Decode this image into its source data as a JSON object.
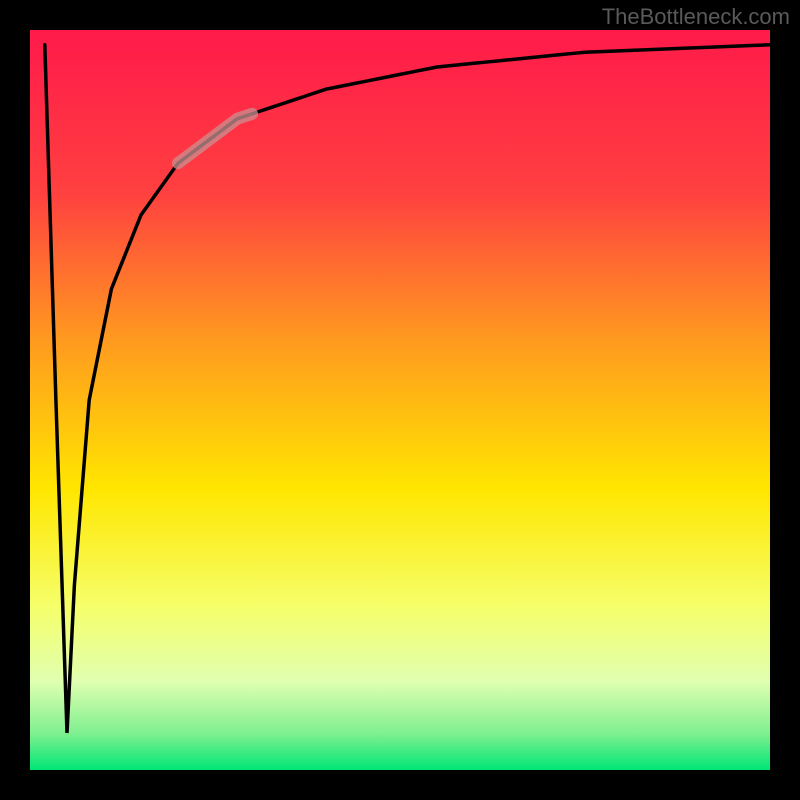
{
  "watermark": "TheBottleneck.com",
  "chart_data": {
    "type": "line",
    "title": "",
    "xlabel": "",
    "ylabel": "",
    "xlim": [
      0,
      100
    ],
    "ylim": [
      0,
      100
    ],
    "description": "Bottleneck percentage curve showing a V-shaped dip near the origin followed by an asymptotic rise toward 100%",
    "gradient_colors": {
      "top": "#ff1a4a",
      "mid_upper": "#ff6b35",
      "mid": "#ffd400",
      "mid_lower": "#f5ff8a",
      "lower": "#e8ffcc",
      "bottom": "#00e676"
    },
    "highlight_region": {
      "x_start": 20,
      "x_end": 30,
      "note": "faded/highlighted segment of curve"
    },
    "series": [
      {
        "name": "bottleneck-curve",
        "points": [
          {
            "x": 2.0,
            "y": 98
          },
          {
            "x": 3.5,
            "y": 50
          },
          {
            "x": 5.0,
            "y": 5
          },
          {
            "x": 6.0,
            "y": 25
          },
          {
            "x": 8.0,
            "y": 50
          },
          {
            "x": 11.0,
            "y": 65
          },
          {
            "x": 15.0,
            "y": 75
          },
          {
            "x": 20.0,
            "y": 82
          },
          {
            "x": 28.0,
            "y": 88
          },
          {
            "x": 40.0,
            "y": 92
          },
          {
            "x": 55.0,
            "y": 95
          },
          {
            "x": 75.0,
            "y": 97
          },
          {
            "x": 100.0,
            "y": 98
          }
        ]
      }
    ]
  }
}
